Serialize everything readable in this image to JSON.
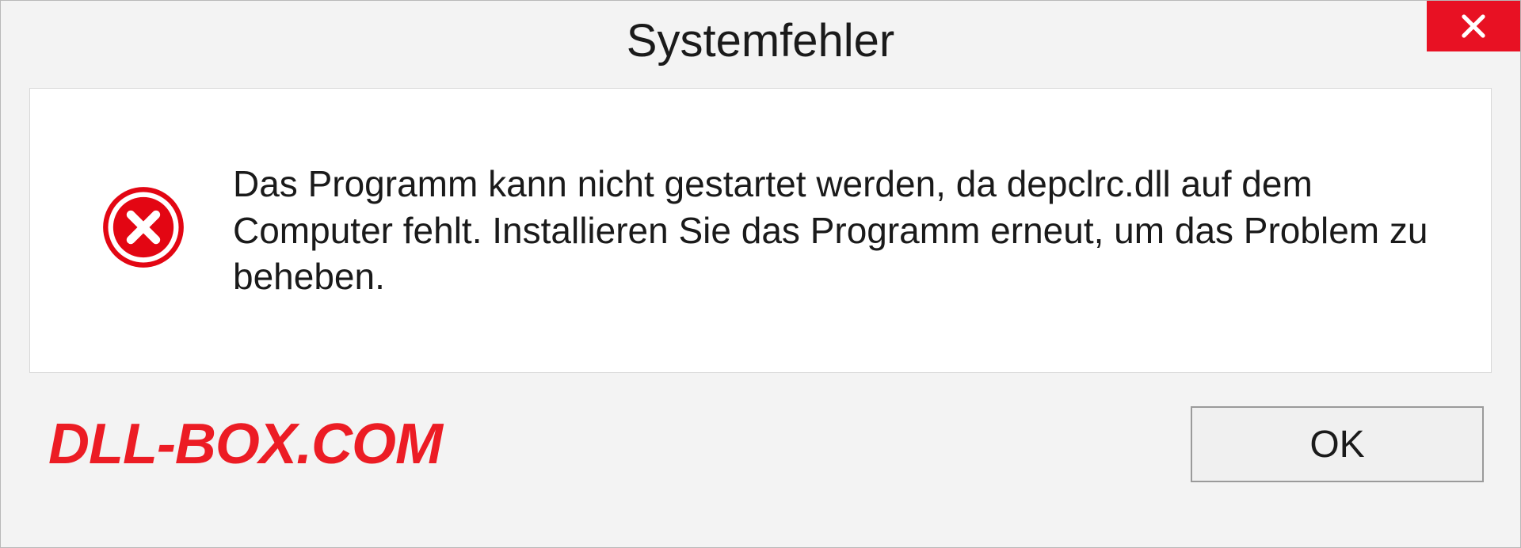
{
  "dialog": {
    "title": "Systemfehler",
    "message": "Das Programm kann nicht gestartet werden, da depclrc.dll auf dem Computer fehlt. Installieren Sie das Programm erneut, um das Problem zu beheben.",
    "ok_label": "OK"
  },
  "watermark": "DLL-BOX.COM",
  "colors": {
    "close_bg": "#e81123",
    "error_icon": "#e30613",
    "watermark": "#ec1c24"
  }
}
